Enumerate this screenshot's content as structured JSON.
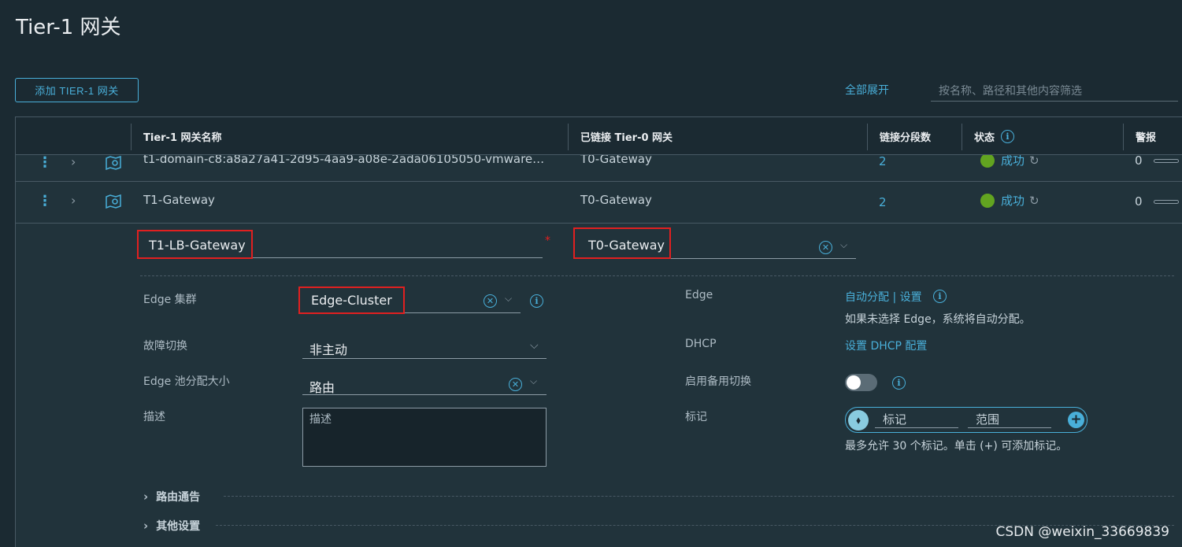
{
  "page": {
    "title": "Tier-1 网关"
  },
  "toolbar": {
    "add_label": "添加 TIER-1 网关",
    "expand_all": "全部展开",
    "filter_placeholder": "按名称、路径和其他内容筛选"
  },
  "grid": {
    "columns": {
      "name": "Tier-1 网关名称",
      "t0": "已链接 Tier-0 网关",
      "segments": "链接分段数",
      "status": "状态",
      "alarms": "警报"
    },
    "rows": [
      {
        "name": "t1-domain-c8:a8a27a41-2d95-4aa9-a08e-2ada06105050-vmware…",
        "t0": "T0-Gateway",
        "segments": "2",
        "status": "成功",
        "alarms": "0"
      },
      {
        "name": "T1-Gateway",
        "t0": "T0-Gateway",
        "segments": "2",
        "status": "成功",
        "alarms": "0"
      }
    ]
  },
  "edit": {
    "name_value": "T1-LB-Gateway",
    "required_mark": "*",
    "t0_value": "T0-Gateway",
    "edge_cluster_label": "Edge 集群",
    "edge_cluster_value": "Edge-Cluster",
    "failover_label": "故障切换",
    "failover_value": "非主动",
    "pool_size_label": "Edge 池分配大小",
    "pool_size_value": "路由",
    "description_label": "描述",
    "description_placeholder": "描述",
    "edge_label": "Edge",
    "edge_link": "自动分配 | 设置",
    "edge_help": "如果未选择 Edge，系统将自动分配。",
    "dhcp_label": "DHCP",
    "dhcp_link": "设置 DHCP 配置",
    "standby_label": "启用备用切换",
    "standby_enabled": false,
    "tags_label": "标记",
    "tag_placeholder": "标记",
    "scope_placeholder": "范围",
    "tags_help": "最多允许 30 个标记。单击 (+) 可添加标记。",
    "section_route": "路由通告",
    "section_other": "其他设置"
  },
  "watermark": "CSDN @weixin_33669839",
  "colors": {
    "accent": "#49afd9",
    "success": "#62a420",
    "highlight": "#e02020",
    "background": "#1b2a32"
  }
}
